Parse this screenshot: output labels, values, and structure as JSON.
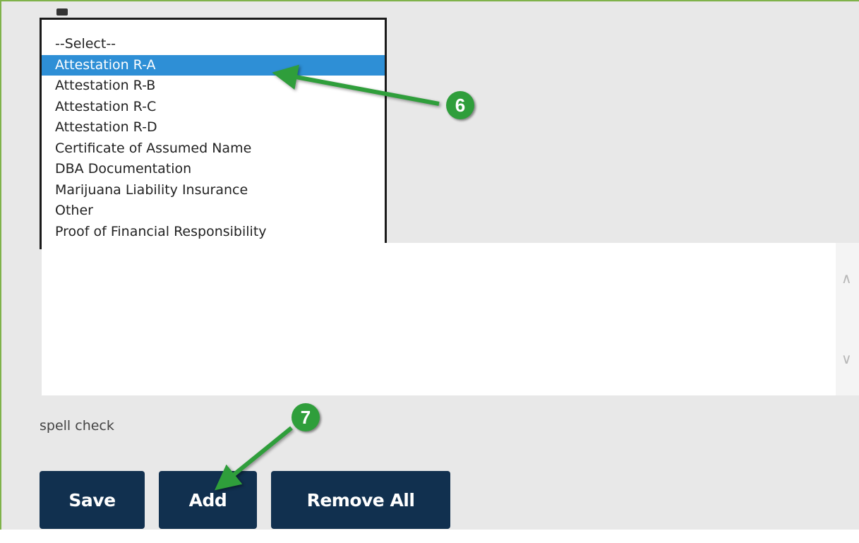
{
  "document_type_list": {
    "options": [
      "--Select--",
      "Attestation R-A",
      "Attestation R-B",
      "Attestation R-C",
      "Attestation R-D",
      "Certificate of Assumed Name",
      "DBA Documentation",
      "Marijuana Liability Insurance",
      "Other",
      "Proof of Financial Responsibility"
    ],
    "selected": "Attestation R-A"
  },
  "spell_check_label": "spell check",
  "buttons": {
    "save": "Save",
    "add": "Add",
    "remove_all": "Remove All"
  },
  "callouts": {
    "step_6": "6",
    "step_7": "7"
  },
  "colors": {
    "selection": "#2e8fd6",
    "button": "#11304f",
    "callout": "#2f9e3b",
    "frame_border": "#7fb24a"
  },
  "icons": {
    "scroll_up": "chevron-up-icon",
    "scroll_down": "chevron-down-icon"
  }
}
